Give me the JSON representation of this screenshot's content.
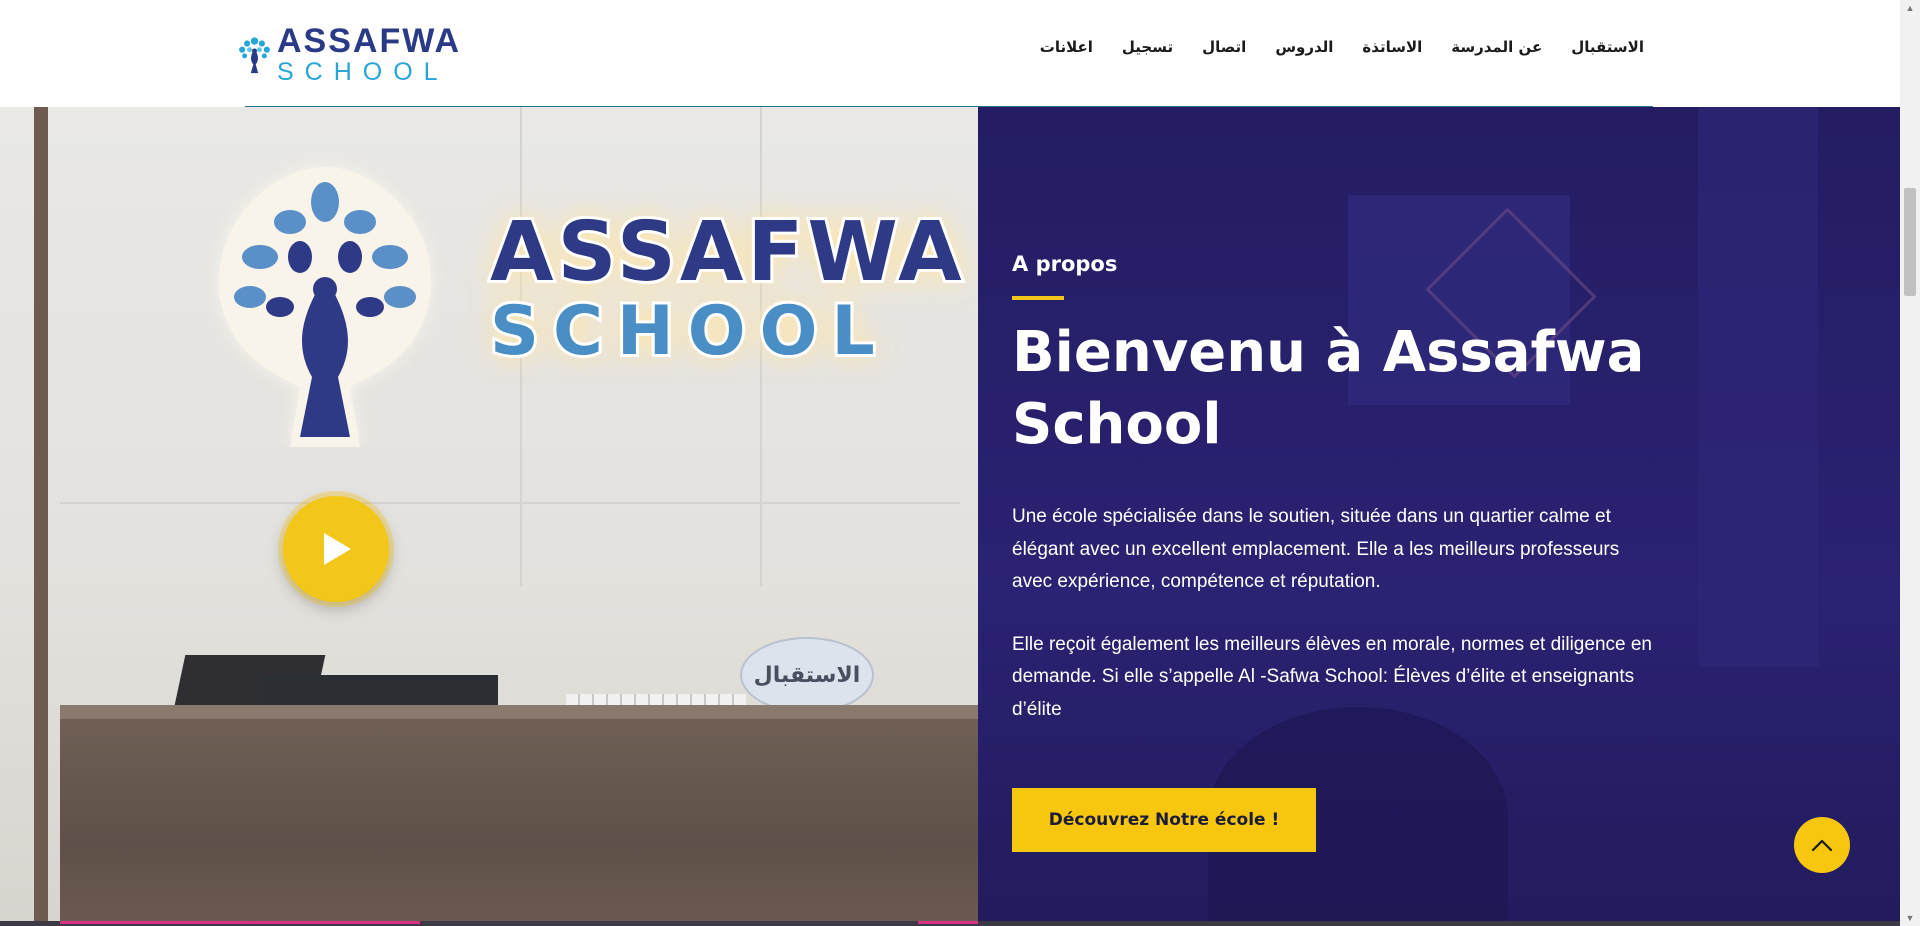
{
  "header": {
    "logo": {
      "word1": "ASSAFWA",
      "word2": "SCHOOL"
    },
    "nav": [
      "الاستقبال",
      "عن المدرسة",
      "الاساتذة",
      "الدروس",
      "اتصال",
      "تسجيل",
      "اعلانات"
    ]
  },
  "hero_image": {
    "sign_word1": "ASSAFWA",
    "sign_word2": "SCHOOL",
    "desk_plaque": "الاستقبال"
  },
  "about": {
    "kicker": "A propos",
    "headline": "Bienvenu à Assafwa School",
    "paragraph1": "Une école spécialisée dans le soutien, située dans un quartier calme et élégant avec un excellent emplacement. Elle a les meilleurs professeurs avec expérience, compétence et réputation.",
    "paragraph2": "Elle reçoit également les meilleurs élèves en morale, normes et diligence en demande. Si elle s’appelle Al -Safwa School: Élèves d’élite et enseignants d’élite",
    "cta_label": "Découvrez Notre école !"
  },
  "icons": {
    "play": "play-icon",
    "back_to_top": "chevron-up-icon"
  },
  "colors": {
    "accent_yellow": "#f7c60f",
    "panel_navy": "#241d63",
    "logo_dark": "#2a3a86",
    "logo_light": "#29a6d8"
  }
}
